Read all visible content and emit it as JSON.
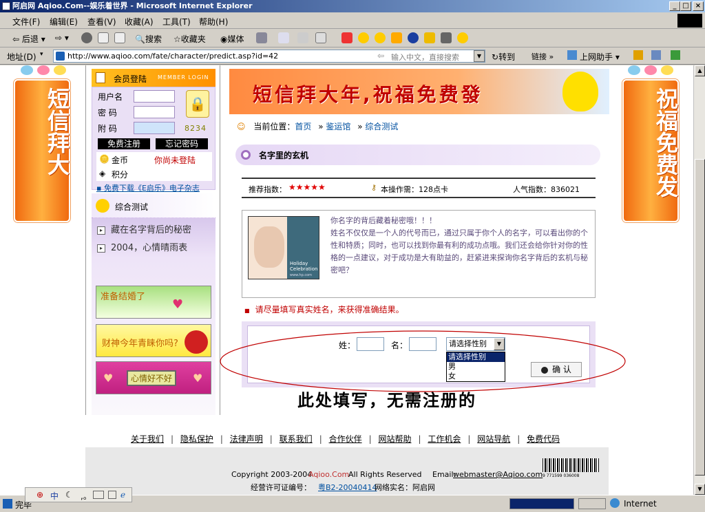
{
  "window": {
    "title": "阿启网 Aqioo.Com--娱乐着世界 - Microsoft Internet Explorer",
    "buttons": [
      "_",
      "□",
      "×"
    ]
  },
  "menu": [
    "文件(F)",
    "编辑(E)",
    "查看(V)",
    "收藏(A)",
    "工具(T)",
    "帮助(H)"
  ],
  "toolbar": {
    "back": "后退",
    "search": "搜索",
    "favorites": "收藏夹",
    "media": "媒体"
  },
  "address": {
    "label": "地址(D)",
    "url": "http://www.aqioo.com/fate/character/predict.asp?id=42",
    "hint": "输入中文，直接搜索",
    "go": "转到",
    "links": "链接",
    "assistant": "上网助手"
  },
  "side_banners": {
    "left": "短信拜大",
    "right": "祝福免费发"
  },
  "login": {
    "header": "会员登陆",
    "header_en": "MEMBER LOGIN",
    "user_label": "用户名",
    "pwd_label": "密  码",
    "code_label": "附  码",
    "code_value": "8234",
    "register": "免费注册",
    "forgot": "忘记密码",
    "gold_label": "金币",
    "not_logged": "你尚未登陆",
    "points_label": "积分",
    "download": "▪ 免费下载《E启乐》电子杂志"
  },
  "tests": {
    "header": "综合测试",
    "items": [
      "藏在名字背后的秘密",
      "2004，心情晴雨表"
    ]
  },
  "ads": [
    "准备结婚了",
    "财神今年青睐你吗?",
    "心情好不好"
  ],
  "banner": {
    "text": "短信拜大年,祝福免费發"
  },
  "breadcrumb": {
    "label": "当前位置：",
    "home": "首页",
    "sep": "»",
    "hall": "鉴运馆",
    "current": "综合测试"
  },
  "section": {
    "title": "名字里的玄机"
  },
  "info": {
    "recommend": "推荐指数：",
    "stars": "★★★★★",
    "cost": "本操作需：128点卡",
    "popularity": "人气指数：836021"
  },
  "desc": {
    "headline": "你名字的背后藏着秘密哦！！！",
    "body": "姓名不仅仅是一个人的代号而已，通过只属于你个人的名字，可以看出你的个性和特质；同时，也可以找到你最有利的成功点哦。我们还会给你针对你的性格的一点建议，对于成功是大有助益的，赶紧进来探询你名字背后的玄机与秘密吧？",
    "image_text": "Holiday Celebration",
    "image_sub": "www.hp.com"
  },
  "notice": "请尽量填写真实姓名，来获得准确结果。",
  "form": {
    "surname_label": "姓：",
    "name_label": "名：",
    "gender_selected": "请选择性别",
    "gender_options": [
      "请选择性别",
      "男",
      "女"
    ],
    "submit": "确 认"
  },
  "annotation": "此处填写，无需注册的",
  "footer": {
    "links": [
      "关于我们",
      "隐私保护",
      "法律声明",
      "联系我们",
      "合作伙伴",
      "网站帮助",
      "工作机会",
      "网站导航",
      "免费代码"
    ],
    "copyright": "Copyright  2003-2004",
    "brand": "Aqioo.Com",
    "rights": "All Rights Reserved",
    "email_label": "Email:",
    "email": "webmaster@Aqioo.com",
    "license_label": "经营许可证编号：",
    "license": "粤B2-20040414",
    "realname": "网络实名：阿启网",
    "barcode": "9 771599 036008"
  },
  "status": {
    "text": "完毕",
    "zone": "Internet",
    "ime": "中"
  },
  "colors": {
    "titlebar": "#0a246a",
    "accent_red": "#c00000",
    "link": "#0050a0",
    "purple": "#eae0f5",
    "orange": "#ff9000"
  }
}
